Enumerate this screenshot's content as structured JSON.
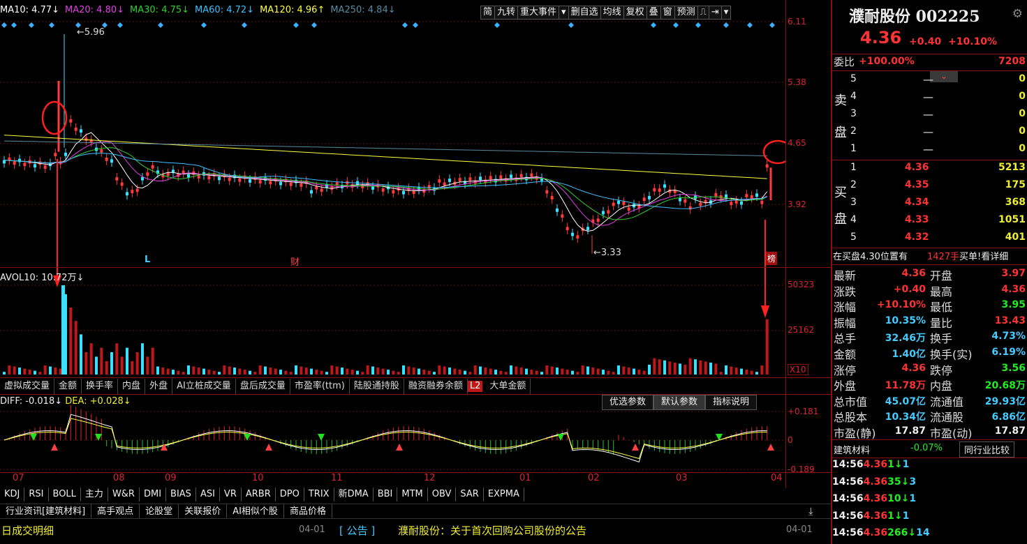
{
  "ma": [
    {
      "label": "MA10: 4.77↓",
      "color": "#ffffff"
    },
    {
      "label": "MA20: 4.80↓",
      "color": "#e040e0"
    },
    {
      "label": "MA30: 4.75↓",
      "color": "#30d030"
    },
    {
      "label": "MA60: 4.72↓",
      "color": "#40c0ff"
    },
    {
      "label": "MA120: 4.96↑",
      "color": "#ffff40"
    },
    {
      "label": "MA250: 4.84↓",
      "color": "#5a8aa0"
    }
  ],
  "tools": [
    "简",
    "九转",
    "重大事件",
    "▾",
    "删自选",
    "均线",
    "复权",
    "叠",
    "窗",
    "预测",
    "⎍",
    "⇥",
    "▾"
  ],
  "price_axis": [
    "6.11",
    "5.38",
    "4.65",
    "3.92"
  ],
  "price_marks": {
    "high": "5.96",
    "low": "3.33"
  },
  "chart_markers": {
    "l": "L",
    "cai": "财",
    "bang": "榜"
  },
  "vol_label": "AVOL10: 10.72万↓",
  "vol_axis": [
    "50323",
    "25162",
    "X10"
  ],
  "indicator_tabs": [
    "虚拟成交量",
    "金额",
    "换手率",
    "内盘",
    "外盘",
    "AI立桩成交量",
    "盘后成交量",
    "市盈率(ttm)",
    "陆股通持股",
    "融资融券余额",
    "L2",
    "大单金额"
  ],
  "macd": {
    "diff": "DIFF: -0.018↓",
    "dea": "DEA: +0.028↓"
  },
  "macd_axis": [
    "+0.181",
    "0",
    "-0.189"
  ],
  "param_tabs": [
    "优选参数",
    "默认参数",
    "指标说明"
  ],
  "months": [
    "07",
    "08",
    "09",
    "10",
    "11",
    "12",
    "01",
    "02",
    "03",
    "04"
  ],
  "bottom_tabs": [
    "KDJ",
    "RSI",
    "BOLL",
    "主力",
    "W&R",
    "DMI",
    "BIAS",
    "ASI",
    "VR",
    "ARBR",
    "DPO",
    "TRIX",
    "新DMA",
    "BBI",
    "MTM",
    "OBV",
    "SAR",
    "EXPMA"
  ],
  "news_tabs": [
    "行业资讯[建筑材料]",
    "高手观点",
    "论股堂",
    "关联报价",
    "AI相似个股",
    "商品价格"
  ],
  "news": {
    "left": "日成交明细",
    "date": "04-01",
    "tag": "公告",
    "text": "濮耐股份：关于首次回购公司股份的公告",
    "date2": "04-01"
  },
  "stock": {
    "name": "濮耐股份 002225",
    "price": "4.36",
    "chg": "+0.40",
    "pct": "+10.10%"
  },
  "weibi": {
    "label": "委比",
    "value": "+100.00%",
    "vol": "7208"
  },
  "sell": [
    {
      "n": "5",
      "p": "—",
      "v": "0"
    },
    {
      "n": "4",
      "p": "—",
      "v": "0"
    },
    {
      "n": "3",
      "p": "—",
      "v": "0"
    },
    {
      "n": "2",
      "p": "—",
      "v": "0"
    },
    {
      "n": "1",
      "p": "—",
      "v": "0"
    }
  ],
  "sell_label": [
    "卖",
    "盘"
  ],
  "buy": [
    {
      "n": "1",
      "p": "4.36",
      "v": "5213"
    },
    {
      "n": "2",
      "p": "4.35",
      "v": "175"
    },
    {
      "n": "3",
      "p": "4.34",
      "v": "368"
    },
    {
      "n": "4",
      "p": "4.33",
      "v": "1051"
    },
    {
      "n": "5",
      "p": "4.32",
      "v": "401"
    }
  ],
  "buy_label": [
    "买",
    "盘"
  ],
  "notice": {
    "text": "在买盘4.30位置有",
    "vol": "1427手",
    "tail": "买单!看详细"
  },
  "quote": [
    {
      "l1": "最新",
      "v1": "4.36",
      "c1": "red",
      "l2": "开盘",
      "v2": "3.97",
      "c2": "red"
    },
    {
      "l1": "涨跌",
      "v1": "+0.40",
      "c1": "red",
      "l2": "最高",
      "v2": "4.36",
      "c2": "red"
    },
    {
      "l1": "涨幅",
      "v1": "+10.10%",
      "c1": "red",
      "l2": "最低",
      "v2": "3.95",
      "c2": "green"
    },
    {
      "l1": "振幅",
      "v1": "10.35%",
      "c1": "cyan",
      "l2": "量比",
      "v2": "13.43",
      "c2": "red"
    },
    {
      "l1": "总手",
      "v1": "32.46万",
      "c1": "cyan",
      "l2": "换手",
      "v2": "4.73%",
      "c2": "cyan"
    },
    {
      "l1": "金额",
      "v1": "1.40亿",
      "c1": "cyan",
      "l2": "换手(实)",
      "v2": "6.19%",
      "c2": "cyan"
    },
    {
      "l1": "涨停",
      "v1": "4.36",
      "c1": "red",
      "l2": "跌停",
      "v2": "3.56",
      "c2": "green"
    },
    {
      "l1": "外盘",
      "v1": "11.78万",
      "c1": "red",
      "l2": "内盘",
      "v2": "20.68万",
      "c2": "green"
    },
    {
      "l1": "总市值",
      "v1": "45.07亿",
      "c1": "cyan",
      "l2": "流通值",
      "v2": "29.93亿",
      "c2": "cyan"
    },
    {
      "l1": "总股本",
      "v1": "10.34亿",
      "c1": "cyan",
      "l2": "流通股",
      "v2": "6.86亿",
      "c2": "cyan"
    },
    {
      "l1": "市盈(静)",
      "v1": "17.87",
      "c1": "white",
      "l2": "市盈(动)",
      "v2": "17.87",
      "c2": "white"
    }
  ],
  "industry": {
    "name": "建筑材料",
    "pct": "-0.07%",
    "btn": "同行业比较"
  },
  "ticks": [
    {
      "t": "14:56",
      "p": "4.36",
      "v": "1",
      "n": "1"
    },
    {
      "t": "14:56",
      "p": "4.36",
      "v": "35",
      "n": "3"
    },
    {
      "t": "14:56",
      "p": "4.36",
      "v": "10",
      "n": "1"
    },
    {
      "t": "14:56",
      "p": "4.36",
      "v": "1",
      "n": "1"
    },
    {
      "t": "14:56",
      "p": "4.36",
      "v": "266",
      "n": "14"
    }
  ]
}
